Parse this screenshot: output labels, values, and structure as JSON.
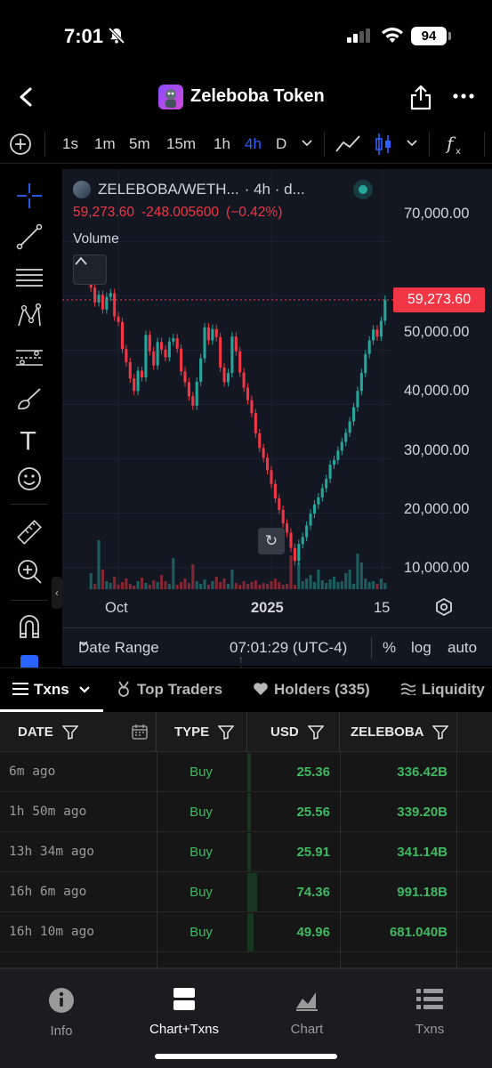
{
  "status_bar": {
    "time": "7:01",
    "battery": "94"
  },
  "header": {
    "title": "Zeleboba Token"
  },
  "timeframes": [
    "1s",
    "1m",
    "5m",
    "15m",
    "1h",
    "4h",
    "D"
  ],
  "active_timeframe": "4h",
  "chart_legend": {
    "symbol": "ZELEBOBA/WETH...",
    "interval": "· 4h · d...",
    "last_price": "59,273.60",
    "change": "-248.005600",
    "change_pct": "(−0.42%)",
    "volume_label": "Volume"
  },
  "price_tag": "59,273.60",
  "colors": {
    "up": "#26a69a",
    "down": "#f23645",
    "accent": "#2962ff",
    "buy": "#3fb861"
  },
  "chart_data": {
    "type": "candlestick",
    "title": "ZELEBOBA/WETH",
    "interval": "4h",
    "y_ticks": [
      "70,000.00",
      "60,000.00",
      "50,000.00",
      "40,000.00",
      "30,000.00",
      "20,000.00",
      "10,000.00"
    ],
    "x_ticks": [
      "Oct",
      "2025",
      "15"
    ],
    "ylim": [
      6000,
      74000
    ],
    "last": 59273.6,
    "close_series": [
      61500,
      58800,
      60200,
      57500,
      59800,
      60500,
      56200,
      55200,
      50200,
      47800,
      44800,
      42500,
      46200,
      45000,
      52800,
      49800,
      47200,
      51500,
      50100,
      48700,
      51600,
      52200,
      50300,
      46100,
      44100,
      41500,
      39800,
      44200,
      48500,
      54200,
      51800,
      53900,
      52400,
      46800,
      44100,
      45800,
      52500,
      49800,
      45900,
      43100,
      40800,
      38400,
      34700,
      32000,
      30200,
      27900,
      25400,
      22700,
      20600,
      18100,
      16400,
      13600,
      11200,
      14300,
      15600,
      17700,
      19900,
      21600,
      22900,
      24600,
      26300,
      28900,
      29800,
      31500,
      33100,
      34800,
      36900,
      39500,
      42500,
      45800,
      49300,
      51800,
      53800,
      52500,
      55400,
      59273.6
    ],
    "volume_heights": [
      18,
      6,
      55,
      22,
      9,
      7,
      14,
      5,
      8,
      12,
      6,
      4,
      9,
      13,
      7,
      5,
      10,
      8,
      16,
      9,
      6,
      35,
      5,
      8,
      12,
      7,
      28,
      9,
      6,
      11,
      5,
      9,
      14,
      8,
      12,
      6,
      22,
      7,
      5,
      9,
      6,
      8,
      10,
      5,
      7,
      6,
      9,
      12,
      8,
      5,
      6,
      38,
      5,
      30,
      9,
      12,
      16,
      8,
      22,
      10,
      7,
      11,
      14,
      8,
      9,
      18,
      22,
      6,
      40,
      30,
      12,
      8,
      9,
      6,
      12,
      7
    ]
  },
  "chart_footer": {
    "date_range": "Date Range",
    "time": "07:01:29 (UTC-4)",
    "percent": "%",
    "log": "log",
    "auto": "auto"
  },
  "tabs": [
    {
      "label": "Txns"
    },
    {
      "label": "Top Traders"
    },
    {
      "label": "Holders (335)"
    },
    {
      "label": "Liquidity"
    }
  ],
  "table": {
    "headers": [
      "DATE",
      "TYPE",
      "USD",
      "ZELEBOBA"
    ],
    "rows": [
      {
        "date": "6m ago",
        "type": "Buy",
        "usd": "25.36",
        "amount": "336.42B",
        "usd_share": 0.04
      },
      {
        "date": "1h 50m ago",
        "type": "Buy",
        "usd": "25.56",
        "amount": "339.20B",
        "usd_share": 0.04
      },
      {
        "date": "13h 34m ago",
        "type": "Buy",
        "usd": "25.91",
        "amount": "341.14B",
        "usd_share": 0.04
      },
      {
        "date": "16h 6m ago",
        "type": "Buy",
        "usd": "74.36",
        "amount": "991.18B",
        "usd_share": 0.11
      },
      {
        "date": "16h 10m ago",
        "type": "Buy",
        "usd": "49.96",
        "amount": "681.040B",
        "usd_share": 0.07
      }
    ]
  },
  "bottom_nav": [
    {
      "label": "Info",
      "icon": "info-icon"
    },
    {
      "label": "Chart+Txns",
      "icon": "chart-txns-icon"
    },
    {
      "label": "Chart",
      "icon": "chart-icon"
    },
    {
      "label": "Txns",
      "icon": "list-icon"
    }
  ],
  "active_bottom_nav": "Chart+Txns"
}
